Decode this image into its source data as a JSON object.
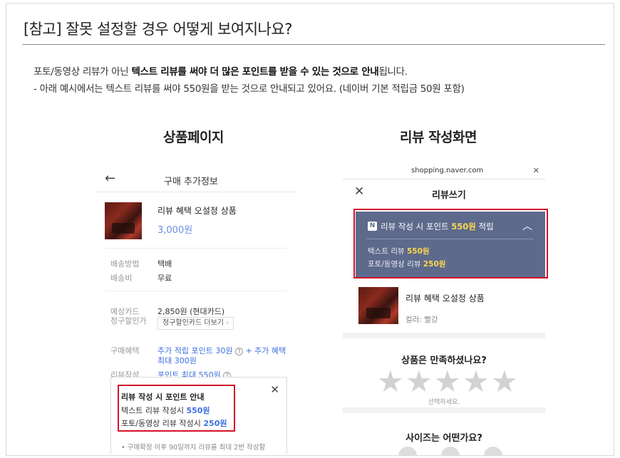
{
  "title": "[참고] 잘못 설정할 경우 어떻게 보여지나요?",
  "desc": {
    "line1_pre": "포토/동영상 리뷰가 아닌 ",
    "line1_bold": "텍스트 리뷰를 써야 더 많은 포인트를 받을 수 있는 것으로 안내",
    "line1_post": "됩니다.",
    "line2": "- 아래 예시에서는 텍스트 리뷰를 써야 550원을 받는 것으로 안내되고 있어요. (네이버 기본 적립금 50원 포함)"
  },
  "left": {
    "col_title": "상품페이지",
    "back_icon": "←",
    "header_title": "구매 추가정보",
    "product_name": "리뷰 혜택 오설정 상품",
    "product_price": "3,000원",
    "rows": [
      {
        "label": "배송방법",
        "value": "택배"
      },
      {
        "label": "배송비",
        "value": "무료"
      }
    ],
    "card_label_1": "예상카드",
    "card_label_2": "청구할인가",
    "card_value": "2,850원 (현대카드)",
    "card_button": "청구할인카드 더보기",
    "benefit_label": "구매혜택",
    "benefit_value_1": "추가 적립 포인트 30원",
    "benefit_plus": "+",
    "benefit_value_2": "추가 혜택",
    "benefit_value_3": "최대 300원",
    "review_label": "리뷰작성",
    "review_value": "포인트 최대 550원",
    "popup": {
      "title": "리뷰 작성 시 포인트 안내",
      "text_label": "텍스트 리뷰 작성시 ",
      "text_value": "550원",
      "photo_label": "포토/동영상 리뷰 작성시 ",
      "photo_value": "250원",
      "close": "✕",
      "note": "• 구매확정 이후 90일까지 리뷰를 최대 2번 작성할"
    }
  },
  "right": {
    "col_title": "리뷰 작성화면",
    "url": "shopping.naver.com",
    "url_close": "✕",
    "close_icon": "✕",
    "header_title": "리뷰쓰기",
    "banner": {
      "n_icon": "N",
      "title_pre": "리뷰 작성 시 포인트 ",
      "title_value": "550원",
      "title_post": " 적립",
      "chevron": "︿",
      "text_label": "텍스트 리뷰 ",
      "text_value": "550원",
      "photo_label": "포토/동영상 리뷰 ",
      "photo_value": "250원"
    },
    "product_name": "리뷰 혜택 오설정 상품",
    "product_option": "컬러: 빨강",
    "question_1": "상품은 만족하셨나요?",
    "star_hint": "선택하세요.",
    "question_2": "사이즈는 어떤가요?"
  },
  "colors": {
    "accent_red": "#d6112a",
    "link_blue": "#3e6fe0",
    "banner_bg": "#5e6a8c",
    "point_yellow": "#ffd84d"
  }
}
